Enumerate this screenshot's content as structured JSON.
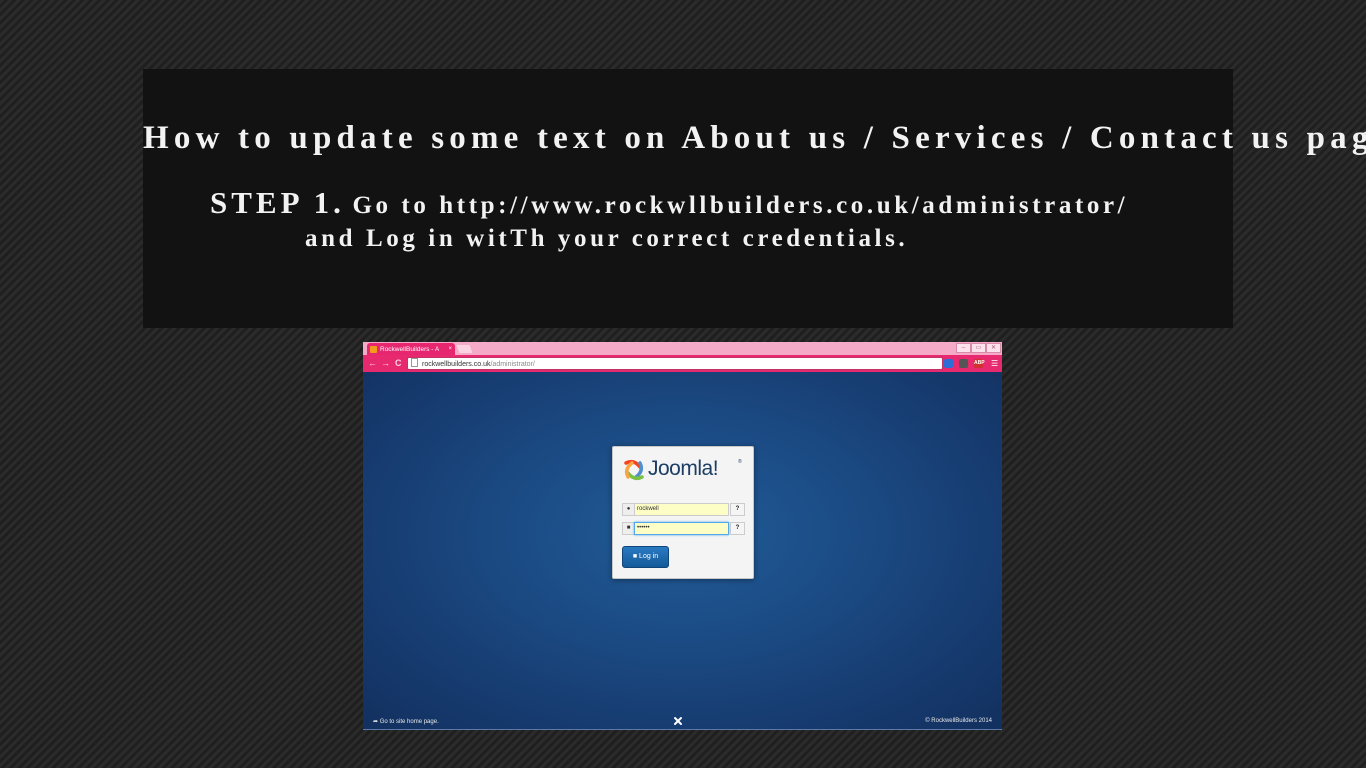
{
  "slide": {
    "title": "How to update some text on About us / Services / Contact us page?",
    "step_label": "STEP 1.",
    "step_text_line1": "Go to http://www.rockwllbuilders.co.uk/administrator/",
    "step_text_line2": "and Log in witTh your correct credentials."
  },
  "browser": {
    "tab_title": "RockwellBuilders - A",
    "tab_close": "×",
    "url_domain": "rockwellbuilders.co.uk",
    "url_path": "/administrator/",
    "window_controls": [
      "–",
      "▭",
      "✕"
    ],
    "extension_badge": "ABP"
  },
  "login": {
    "logo_text": "Joomla!",
    "logo_reg": "®",
    "username_value": "rockwell",
    "password_value": "••••••",
    "help_symbol": "?",
    "login_button": "Log in"
  },
  "footer": {
    "site_link": "Go to site home page.",
    "copyright": "© RockwellBuilders 2014"
  },
  "icons": {
    "back": "←",
    "forward": "→",
    "reload": "C",
    "star": "☆",
    "menu": "☰",
    "user": "👤",
    "lock": "🔒",
    "share": "➦"
  },
  "colors": {
    "tab_accent": "#e6266f",
    "toolbar": "#e7296f",
    "page_bg": "#1b4a83",
    "login_button": "#1f6bb0"
  }
}
